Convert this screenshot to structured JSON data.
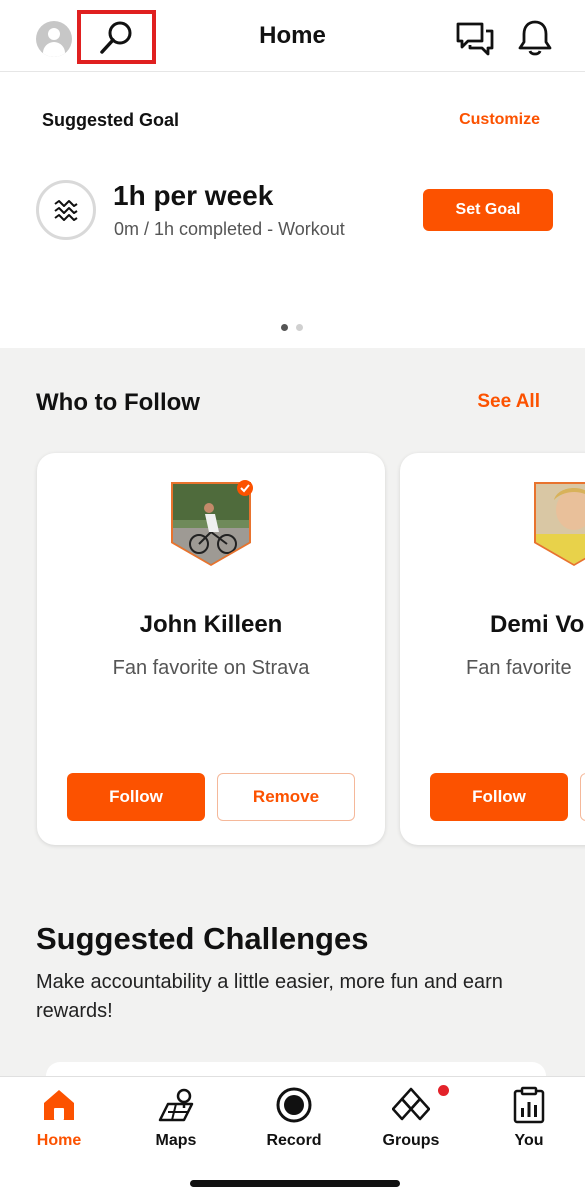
{
  "header": {
    "title": "Home",
    "icons": {
      "avatar": "avatar-icon",
      "search": "search-icon",
      "chat": "chat-icon",
      "notifications": "bell-icon"
    }
  },
  "goal": {
    "section_label": "Suggested Goal",
    "customize_label": "Customize",
    "title": "1h per week",
    "subtitle": "0m / 1h completed - Workout",
    "button_label": "Set Goal",
    "icon": "activity-waves-icon",
    "carousel_pages": 2,
    "carousel_active": 1
  },
  "who_to_follow": {
    "title": "Who to Follow",
    "see_all_label": "See All",
    "cards": [
      {
        "name": "John Killeen",
        "subtitle": "Fan favorite on Strava",
        "verified": true,
        "follow_label": "Follow",
        "remove_label": "Remove"
      },
      {
        "name": "Demi Vo",
        "subtitle": "Fan favorite",
        "verified": false,
        "follow_label": "Follow",
        "remove_label": ""
      }
    ]
  },
  "challenges": {
    "title": "Suggested Challenges",
    "description": "Make accountability a little easier, more fun and earn rewards!"
  },
  "nav": {
    "items": [
      {
        "label": "Home",
        "icon": "home-icon",
        "active": true
      },
      {
        "label": "Maps",
        "icon": "maps-icon",
        "active": false
      },
      {
        "label": "Record",
        "icon": "record-icon",
        "active": false
      },
      {
        "label": "Groups",
        "icon": "groups-icon",
        "active": false,
        "has_badge": true
      },
      {
        "label": "You",
        "icon": "clipboard-stats-icon",
        "active": false
      }
    ]
  },
  "colors": {
    "accent": "#fc5200",
    "badge": "#e3222a",
    "highlight_box": "#e02020"
  }
}
